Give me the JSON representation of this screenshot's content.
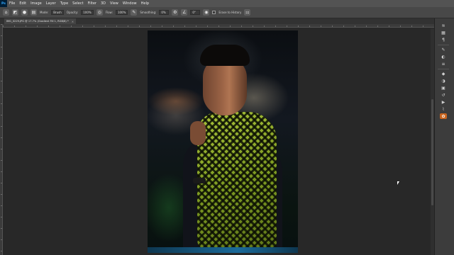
{
  "app": {
    "logo_text": "Ps"
  },
  "menubar": {
    "items": [
      "File",
      "Edit",
      "Image",
      "Layer",
      "Type",
      "Select",
      "Filter",
      "3D",
      "View",
      "Window",
      "Help"
    ]
  },
  "options_bar": {
    "mode_label": "Mode:",
    "mode_value": "Brush",
    "opacity_label": "Opacity:",
    "opacity_value": "100%",
    "flow_label": "Flow:",
    "flow_value": "100%",
    "smoothing_label": "Smoothing:",
    "smoothing_value": "0%",
    "angle_value": "0°",
    "erase_to_history_label": "Erase to History",
    "tool_icon": "eraser-icon"
  },
  "document": {
    "tab_title": "IMG_0229.JPG @ 17.7% (Gradient Fill 1, RGB/8) *",
    "tab_close": "×"
  },
  "panels": {
    "icons": [
      "brush-settings-icon",
      "layers-icon",
      "paragraph-icon",
      "brush-icon",
      "adjustments-icon",
      "properties-icon",
      "shapes-icon",
      "color-icon",
      "swatches-icon",
      "history-icon",
      "actions-icon",
      "paths-icon",
      "channels-icon",
      "libraries-icon"
    ],
    "active_icon": "libraries-icon"
  },
  "colors": {
    "accent": "#c8641e",
    "workspace": "#282828",
    "menubar": "#535353"
  }
}
